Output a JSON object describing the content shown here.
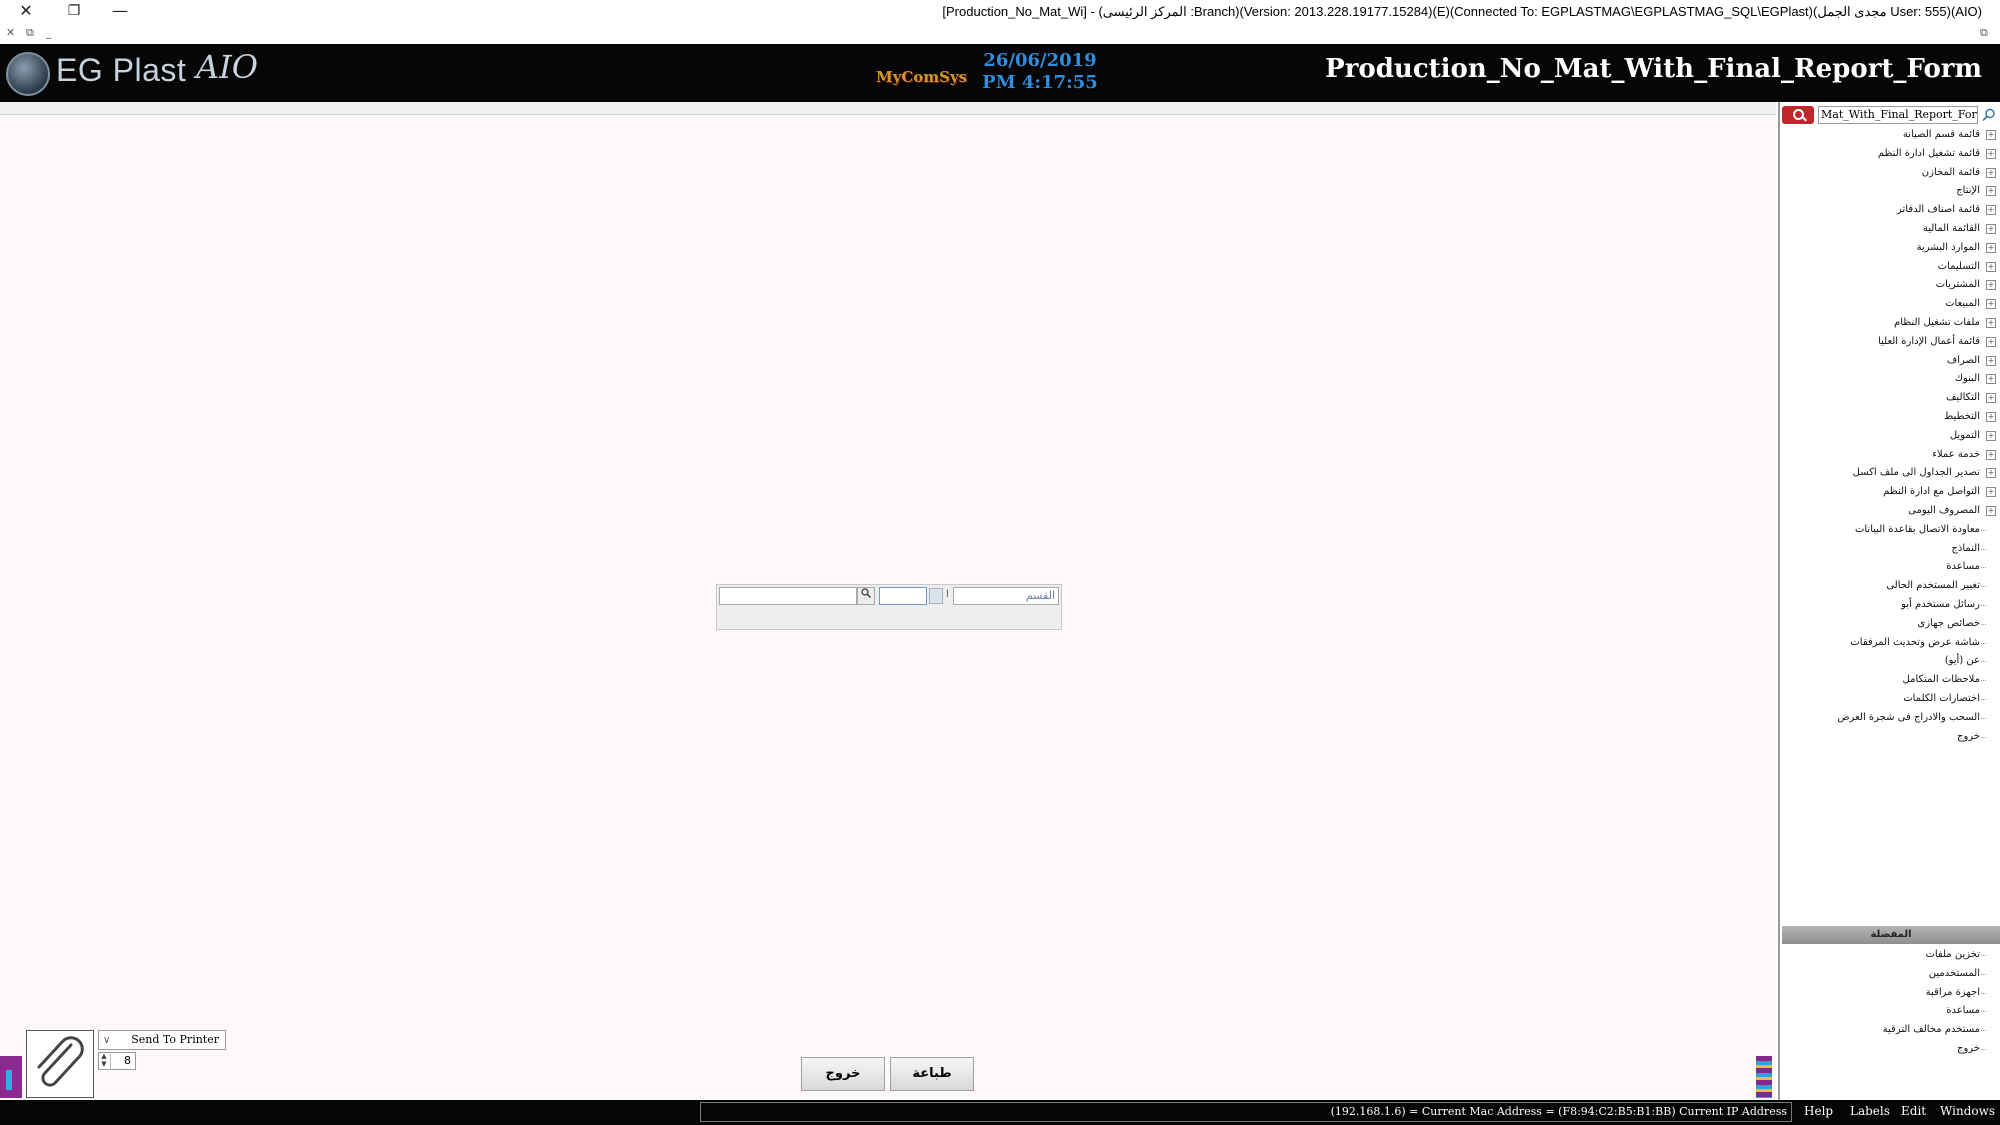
{
  "window": {
    "title": "[Production_No_Mat_Wi] - (المركز الرئيسى :Branch)(Version: 2013.228.19177.15284)(E)(Connected To: EGPLASTMAG\\EGPLASTMAG_SQL\\EGPlast)(مجدى الجمل User: 555)(AIO)",
    "close_glyph": "✕",
    "restore_glyph": "❐",
    "minimize_glyph": "—"
  },
  "mdi": {
    "close": "✕",
    "restore": "⧉",
    "minimize": "_"
  },
  "header": {
    "logo_text": "EG Plast",
    "logo_suffix": "AIO",
    "brand_mini": "MyComSys",
    "date": "26/06/2019",
    "time": "PM 4:17:55",
    "form_title": "Production_No_Mat_With_Final_Report_Form"
  },
  "center_form": {
    "input_left_value": "",
    "input_mid_value": "",
    "input_right_value": "القسم",
    "separator_label": "ا"
  },
  "sidebar": {
    "search_value": "Mat_With_Final_Report_Form",
    "tree_items": [
      {
        "label": "قائمة قسم الصيانة",
        "expandable": true
      },
      {
        "label": "قائمة تشغيل ادارة النظم",
        "expandable": true
      },
      {
        "label": "قائمة المخازن",
        "expandable": true
      },
      {
        "label": "الإنتاج",
        "expandable": true
      },
      {
        "label": "قائمة اصناف الدفاتر",
        "expandable": true
      },
      {
        "label": "القائمة المالية",
        "expandable": true
      },
      {
        "label": "الموارد البشرية",
        "expandable": true
      },
      {
        "label": "التسليمات",
        "expandable": true
      },
      {
        "label": "المشتريات",
        "expandable": true
      },
      {
        "label": "المبيعات",
        "expandable": true
      },
      {
        "label": "ملفات تشغيل النظام",
        "expandable": true
      },
      {
        "label": "قائمة أعمال الإدارة العليا",
        "expandable": true
      },
      {
        "label": "الصراف",
        "expandable": true
      },
      {
        "label": "البنوك",
        "expandable": true
      },
      {
        "label": "التكاليف",
        "expandable": true
      },
      {
        "label": "التخطيط",
        "expandable": true
      },
      {
        "label": "التمويل",
        "expandable": true
      },
      {
        "label": "خدمة عملاء",
        "expandable": true
      },
      {
        "label": "تصدير الجداول الى ملف اكسل",
        "expandable": true
      },
      {
        "label": "التواصل مع ادارة النظم",
        "expandable": true
      },
      {
        "label": "المصروف اليومى",
        "expandable": true
      },
      {
        "label": "معاودة الاتصال بقاعدة البيانات",
        "expandable": false
      },
      {
        "label": "النماذج",
        "expandable": false
      },
      {
        "label": "مساعدة",
        "expandable": false
      },
      {
        "label": "تغيير المستخدم الحالى",
        "expandable": false
      },
      {
        "label": "رسائل مستخدم أبو",
        "expandable": false
      },
      {
        "label": "خصائص جهازى",
        "expandable": false
      },
      {
        "label": "شاشة عرض وتحديث المرفقات",
        "expandable": false
      },
      {
        "label": "عن (أيو)",
        "expandable": false
      },
      {
        "label": "ملاحظات المتكامل",
        "expandable": false
      },
      {
        "label": "اختصارات الكلمات",
        "expandable": false
      },
      {
        "label": "السحب والادراج فى شجرة العرض",
        "expandable": false
      },
      {
        "label": "خروج",
        "expandable": false
      }
    ],
    "favorites_header": "المفضلة",
    "favorites": [
      {
        "label": "تخزين ملفات"
      },
      {
        "label": "المستخدمين"
      },
      {
        "label": "اجهزة مراقبة"
      },
      {
        "label": "مساعدة"
      },
      {
        "label": "مستخدم مخالف الترقية"
      },
      {
        "label": "خروج"
      }
    ]
  },
  "bottom": {
    "printer_option": "Send To Printer",
    "copies": "8",
    "print_button": "طباعة",
    "exit_button": "خروج"
  },
  "statusbar": {
    "info": "(192.168.1.6) = Current Mac Address = (F8:94:C2:B5:B1:BB) Current IP Address",
    "menu": [
      "Help",
      "Labels",
      "Edit",
      "Windows"
    ]
  }
}
